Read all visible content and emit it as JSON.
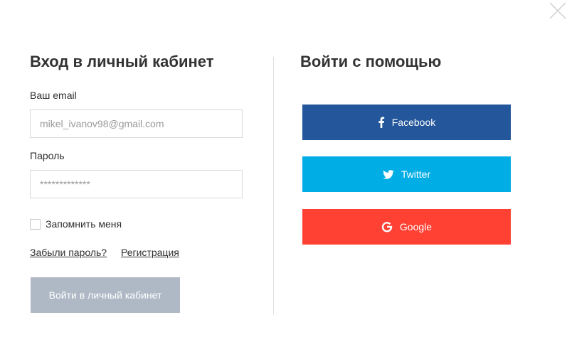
{
  "login": {
    "title": "Вход в личный кабинет",
    "email_label": "Ваш email",
    "email_value": "mikel_ivanov98@gmail.com",
    "password_label": "Пароль",
    "password_value": "*************",
    "remember_label": "Запомнить меня",
    "remember_checked": false,
    "forgot_link": "Забыли пароль?",
    "register_link": "Регистрация",
    "submit_label": "Войти в личный кабинет"
  },
  "social": {
    "title": "Войти с помощью",
    "buttons": [
      {
        "label": "Facebook",
        "icon": "facebook-icon",
        "color": "#23569a"
      },
      {
        "label": "Twitter",
        "icon": "twitter-icon",
        "color": "#00ade5"
      },
      {
        "label": "Google",
        "icon": "google-icon",
        "color": "#ff4133"
      }
    ]
  },
  "colors": {
    "submit_disabled": "#aeb9c5",
    "divider": "#dedede"
  }
}
